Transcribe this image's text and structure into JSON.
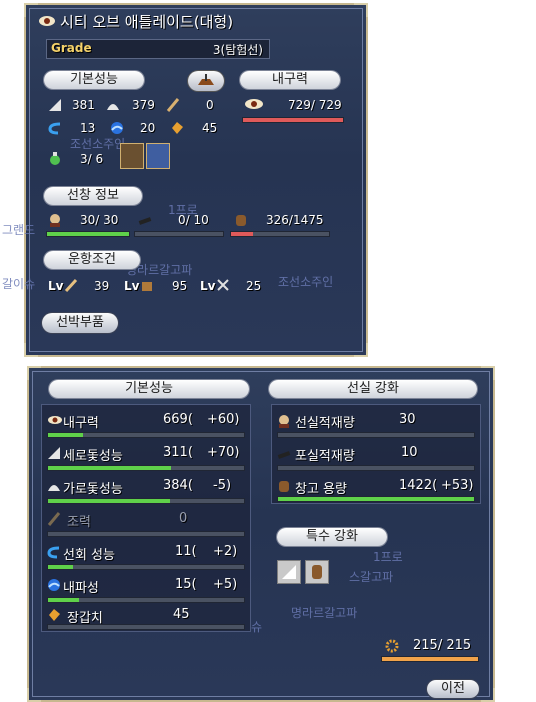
{
  "top": {
    "title": "시티 오브 애틀레이드(대형)",
    "grade_label": "Grade",
    "grade_value": "3(탐험선)",
    "section_basic": "기본성능",
    "section_durability": "내구력",
    "section_cabin": "선창 정보",
    "section_sail": "운항조건",
    "sail_stat": "381",
    "oar_stat": "379",
    "row_stat": "0",
    "durability_value": "729/ 729",
    "turn_stat": "13",
    "wave_stat": "20",
    "armor_stat": "45",
    "bg_text_1": "조선소주인",
    "bonus_value": "3/ 6",
    "crew_value": "30/ 30",
    "cannon_value": "0/ 10",
    "cargo_value": "326/1475",
    "lv_label": "Lv",
    "lv_1": "39",
    "lv_2": "95",
    "lv_3": "25",
    "ship_parts_button": "선박부품",
    "bg_text_2": "1프로",
    "bg_text_3": "그랜드",
    "bg_text_4": "갈이슈",
    "bg_text_5": "명라르갈고파",
    "bg_text_6": "조선소주인",
    "bars": {
      "durability": 1.0,
      "crew": 1.0,
      "cannon": 0.0,
      "cargo": 0.22
    }
  },
  "bottom": {
    "section_basic": "기본성능",
    "section_cabin": "선실 강화",
    "section_special": "특수 강화",
    "stats": [
      {
        "label": "내구력",
        "value": "669(",
        "bonus": "+60)"
      },
      {
        "label": "세로돛성능",
        "value": "311(",
        "bonus": "+70)"
      },
      {
        "label": "가로돛성능",
        "value": "384(",
        "bonus": "-5)"
      },
      {
        "label": "조력",
        "value": "0",
        "bonus": ""
      },
      {
        "label": "선회 성능",
        "value": "11(",
        "bonus": "+2)"
      },
      {
        "label": "내파성",
        "value": "15(",
        "bonus": "+5)"
      },
      {
        "label": "장갑치",
        "value": "45",
        "bonus": ""
      }
    ],
    "stat_bars": [
      0.18,
      0.63,
      0.62,
      0.0,
      0.13,
      0.16,
      0.0
    ],
    "cabin": [
      {
        "label": "선실적재량",
        "value": "30"
      },
      {
        "label": "포실적재량",
        "value": "10"
      },
      {
        "label": "창고 용량",
        "value": "1422(",
        "bonus": "+53)"
      }
    ],
    "cabin_bars": [
      0.0,
      0.0,
      1.0
    ],
    "gauge_value": "215/ 215",
    "prev_button": "이전",
    "bg_text_1": "1프로",
    "bg_text_2": "명라르갈고파",
    "bg_text_3": "스갈고파",
    "bg_text_4": "슈"
  }
}
